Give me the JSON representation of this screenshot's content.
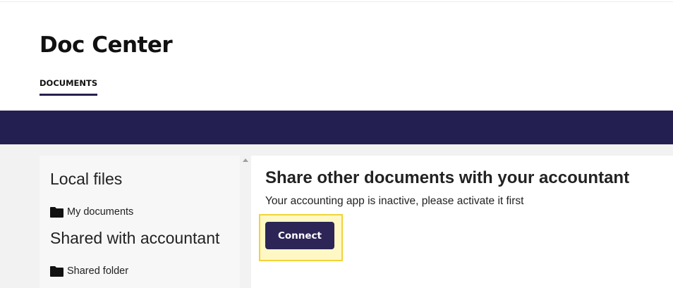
{
  "header": {
    "title": "Doc Center",
    "tabs": [
      {
        "label": "DOCUMENTS",
        "active": true
      }
    ]
  },
  "sidebar": {
    "sections": [
      {
        "heading": "Local files",
        "items": [
          {
            "label": "My documents",
            "icon": "folder-icon"
          }
        ]
      },
      {
        "heading": "Shared with accountant",
        "items": [
          {
            "label": "Shared folder",
            "icon": "folder-icon"
          }
        ]
      }
    ]
  },
  "content": {
    "heading": "Share other documents with your accountant",
    "message": "Your accounting app is inactive, please activate it first",
    "connect_label": "Connect"
  },
  "colors": {
    "brand_navy": "#231f50",
    "button": "#2c2555",
    "highlight_fill": "#fff8c4",
    "highlight_border": "#f1d33a",
    "sidebar_bg": "#f7f7f7",
    "page_bg": "#f2f2f2"
  }
}
